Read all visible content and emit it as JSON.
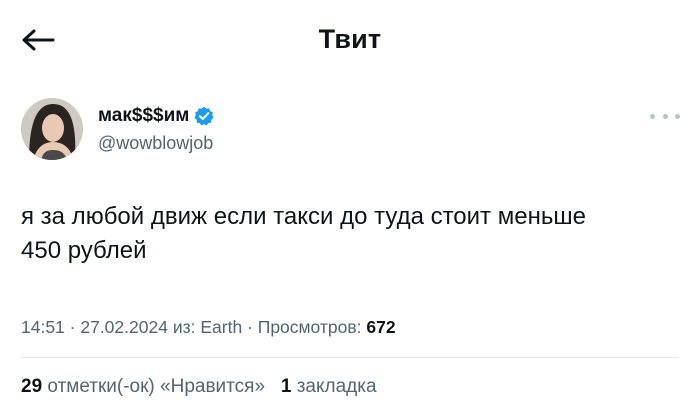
{
  "header": {
    "title": "Твит",
    "back_icon": "arrow-left-icon"
  },
  "tweet": {
    "author": {
      "display_name": "мак$$$им",
      "handle": "@wowblowjob",
      "verified": true,
      "verified_color": "#1d9bf0"
    },
    "text_line1": "я за любой движ если такси до туда стоит меньше",
    "text_line2": "450 рублей",
    "time": "14:51",
    "sep1": " · ",
    "date": "27.02.2024",
    "source_prefix": " из: ",
    "source": "Earth",
    "sep2": " · ",
    "views_label": "Просмотров: ",
    "views_count": "672"
  },
  "stats": {
    "likes_count": "29",
    "likes_label": "отметки(-ок) «Нравится»",
    "bookmarks_count": "1",
    "bookmarks_label": "закладка"
  },
  "colors": {
    "text_primary": "#0f1419",
    "text_secondary": "#536471",
    "accent": "#1d9bf0",
    "divider": "#e4e8eb"
  }
}
